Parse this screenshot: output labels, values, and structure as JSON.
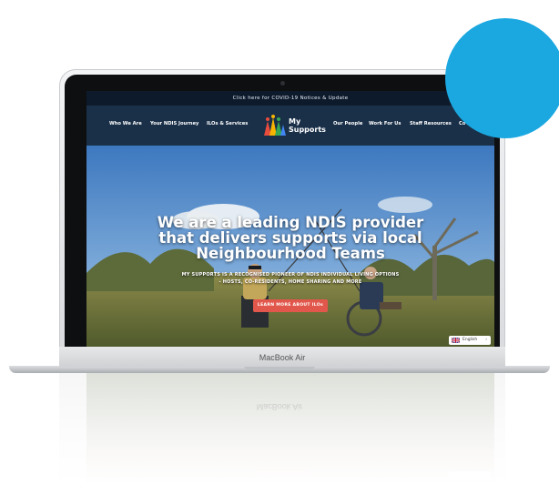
{
  "notice_bar": {
    "text": "Click here for COVID-19 Notices & Update"
  },
  "nav": {
    "items": [
      {
        "label": "Who We Are"
      },
      {
        "label": "Your NDIS Journey"
      },
      {
        "label": "ILOs & Services"
      },
      {
        "label": "Our People"
      },
      {
        "label": "Work For Us"
      },
      {
        "label": "Staff Resources"
      },
      {
        "label": "Co"
      }
    ],
    "logo": {
      "line1": "My",
      "line2": "Supports"
    }
  },
  "hero": {
    "headline_line1": "We are a leading NDIS provider",
    "headline_line2": "that delivers supports via local",
    "headline_line3": "Neighbourhood Teams",
    "subtext_line1": "MY SUPPORTS IS A RECOGNISED PIONEER OF NDIS INDIVIDUAL LIVING OPTIONS",
    "subtext_line2": "- HOSTS, CO-RESIDENTS, HOME SHARING AND MORE",
    "cta_label": "LEARN MORE ABOUT ILOs"
  },
  "language": {
    "label": "English",
    "chevron": "›",
    "flag_icon": "uk-flag-icon"
  },
  "device": {
    "label": "MacBook Air"
  },
  "colors": {
    "notice_bg": "#0d1a2c",
    "nav_bg": "#16283e",
    "cta": "#e2574b",
    "accent_circle": "#1ba8e0"
  }
}
